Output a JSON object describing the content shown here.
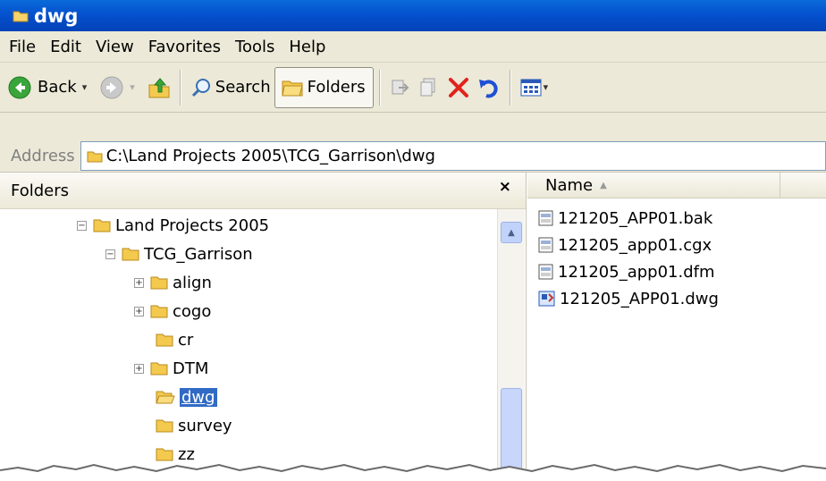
{
  "window": {
    "title": "dwg"
  },
  "menu": [
    "File",
    "Edit",
    "View",
    "Favorites",
    "Tools",
    "Help"
  ],
  "toolbar": {
    "back_label": "Back",
    "search_label": "Search",
    "folders_label": "Folders",
    "icons": [
      "back-arrow-icon",
      "forward-arrow-icon",
      "up-folder-icon",
      "search-icon",
      "folders-icon",
      "move-to-icon",
      "copy-to-icon",
      "delete-icon",
      "undo-icon",
      "views-icon"
    ]
  },
  "address": {
    "label": "Address",
    "path": "C:\\Land Projects 2005\\TCG_Garrison\\dwg"
  },
  "folders_pane": {
    "title": "Folders",
    "close_glyph": "×",
    "tree": [
      {
        "label": "Land Projects 2005",
        "expander": "−"
      },
      {
        "label": "TCG_Garrison",
        "expander": "−"
      },
      {
        "label": "align",
        "expander": "+"
      },
      {
        "label": "cogo",
        "expander": "+"
      },
      {
        "label": "cr",
        "expander": ""
      },
      {
        "label": "DTM",
        "expander": "+"
      },
      {
        "label": "dwg",
        "expander": "",
        "selected": true
      },
      {
        "label": "survey",
        "expander": ""
      },
      {
        "label": "zz",
        "expander": ""
      }
    ]
  },
  "files_pane": {
    "column_name": "Name",
    "files": [
      {
        "name": "121205_APP01.bak",
        "icon": "document-icon"
      },
      {
        "name": "121205_app01.cgx",
        "icon": "document-icon"
      },
      {
        "name": "121205_app01.dfm",
        "icon": "document-icon"
      },
      {
        "name": "121205_APP01.dwg",
        "icon": "dwg-file-icon"
      }
    ]
  },
  "colors": {
    "title_bar": "#0451cf",
    "selection": "#316ac5",
    "chrome": "#ece9d8",
    "delete_red": "#e0231c"
  }
}
